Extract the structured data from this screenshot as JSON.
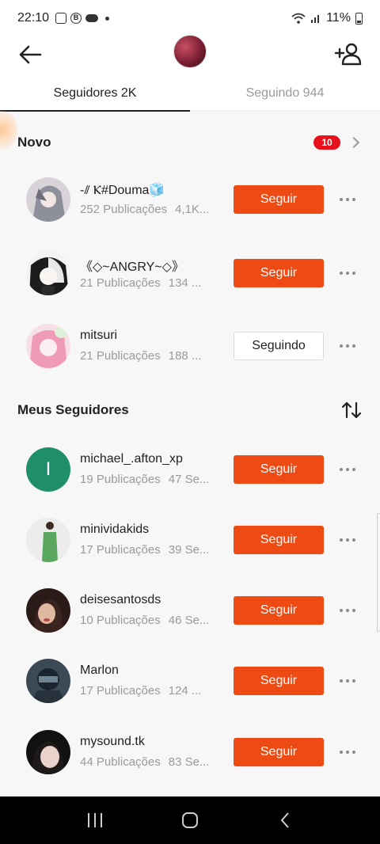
{
  "status_bar": {
    "time": "22:10",
    "battery": "11%"
  },
  "tabs": [
    {
      "label": "Seguidores 2K",
      "active": true
    },
    {
      "label": "Seguindo 944",
      "active": false
    }
  ],
  "novo": {
    "title": "Novo",
    "badge": "10"
  },
  "meus": {
    "title": "Meus Seguidores"
  },
  "users": [
    {
      "name": "-⫽ Ⲕ#Douma🧊",
      "posts": "252 Publicações",
      "sub": "4,1K...",
      "button": "Seguir",
      "state": "follow"
    },
    {
      "name": "《◇~ANGRY~◇》",
      "posts": "21 Publicações",
      "sub": "134 ...",
      "button": "Seguir",
      "state": "follow"
    },
    {
      "name": "mitsuri",
      "posts": "21 Publicações",
      "sub": "188 ...",
      "button": "Seguindo",
      "state": "following"
    },
    {
      "name": "michael_.afton_xp",
      "posts": "19 Publicações",
      "sub": "47 Se...",
      "button": "Seguir",
      "state": "follow",
      "avatar_letter": "I"
    },
    {
      "name": "minividakids",
      "posts": "17 Publicações",
      "sub": "39 Se...",
      "button": "Seguir",
      "state": "follow"
    },
    {
      "name": "deisesantosds",
      "posts": "10 Publicações",
      "sub": "46 Se...",
      "button": "Seguir",
      "state": "follow"
    },
    {
      "name": "Marlon",
      "posts": "17 Publicações",
      "sub": "124 ...",
      "button": "Seguir",
      "state": "follow"
    },
    {
      "name": "mysound.tk",
      "posts": "44 Publicações",
      "sub": "83 Se...",
      "button": "Seguir",
      "state": "follow"
    }
  ],
  "colors": {
    "accent": "#ee4a14",
    "badge": "#e8111b",
    "nav_bg": "#000000"
  },
  "icons": {
    "back": "arrow-left-icon",
    "add_user": "add-user-icon",
    "chevron": "chevron-right-icon",
    "sort": "sort-icon",
    "more": "more-dots-icon"
  }
}
